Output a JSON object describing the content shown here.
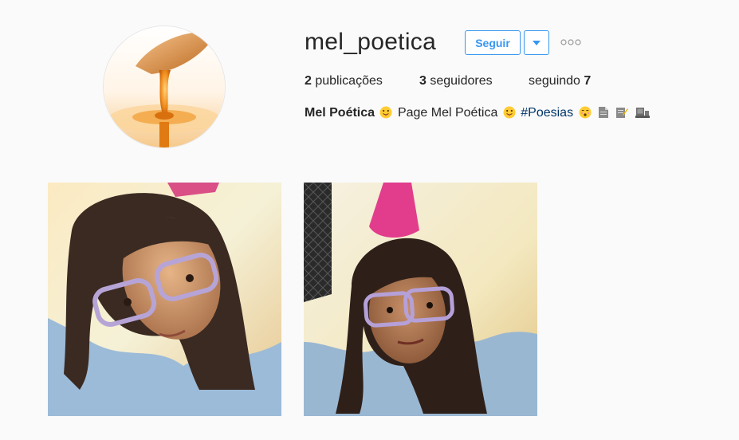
{
  "profile": {
    "username": "mel_poetica",
    "follow_label": "Seguir",
    "dropdown_icon": "caret-down-icon",
    "more_icon": "more-options-icon",
    "avatar_icon": "honey-dripper-avatar"
  },
  "stats": {
    "posts_count": "2",
    "posts_label": "publicações",
    "followers_count": "3",
    "followers_label": "seguidores",
    "following_label": "seguindo",
    "following_count": "7"
  },
  "bio": {
    "name": "Mel Poética",
    "text": "Page Mel Poética",
    "hashtag": "#Poesias",
    "emojis": [
      "tongue-out-emoji",
      "tongue-out-emoji",
      "kiss-emoji",
      "page-emoji",
      "memo-emoji",
      "pc-emoji"
    ]
  },
  "posts": [
    {
      "name": "post-photo-1",
      "alt_icon": "selfie-girl-glasses-photo"
    },
    {
      "name": "post-photo-2",
      "alt_icon": "selfie-girl-glasses-photo"
    }
  ],
  "colors": {
    "accent": "#3897f0",
    "text": "#262626",
    "hashtag": "#003569",
    "background": "#fafafa"
  }
}
